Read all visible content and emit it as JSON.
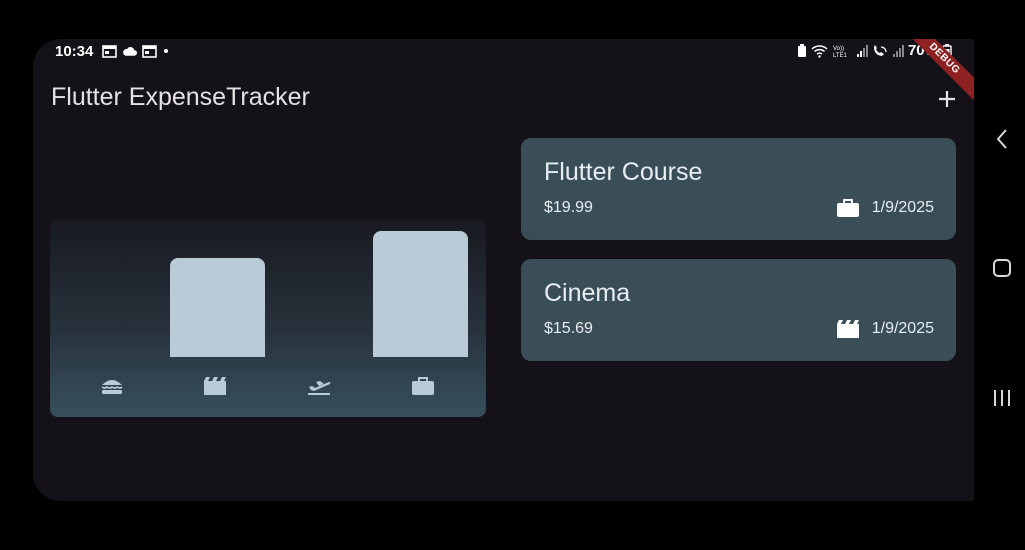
{
  "status_bar": {
    "time": "10:34",
    "battery": "70%",
    "network_label": "Vo) LTE1"
  },
  "debug_banner": "DEBUG",
  "app_bar": {
    "title": "Flutter ExpenseTracker",
    "action_icon": "add-icon"
  },
  "chart_data": {
    "type": "bar",
    "categories": [
      "food",
      "leisure",
      "travel",
      "work"
    ],
    "category_icons": [
      "hamburger-icon",
      "movie-icon",
      "flight-takeoff-icon",
      "briefcase-icon"
    ],
    "values": [
      0,
      15.69,
      0,
      19.99
    ],
    "ylim": [
      0,
      19.99
    ],
    "bar_color": "#b8cbd6"
  },
  "expenses": [
    {
      "title": "Flutter Course",
      "amount": "$19.99",
      "category_icon": "briefcase-icon",
      "date": "1/9/2025"
    },
    {
      "title": "Cinema",
      "amount": "$15.69",
      "category_icon": "movie-icon",
      "date": "1/9/2025"
    }
  ],
  "colors": {
    "background": "#141218",
    "card": "#3a4e58",
    "text": "#e8eef1",
    "debug": "#8e2222"
  }
}
